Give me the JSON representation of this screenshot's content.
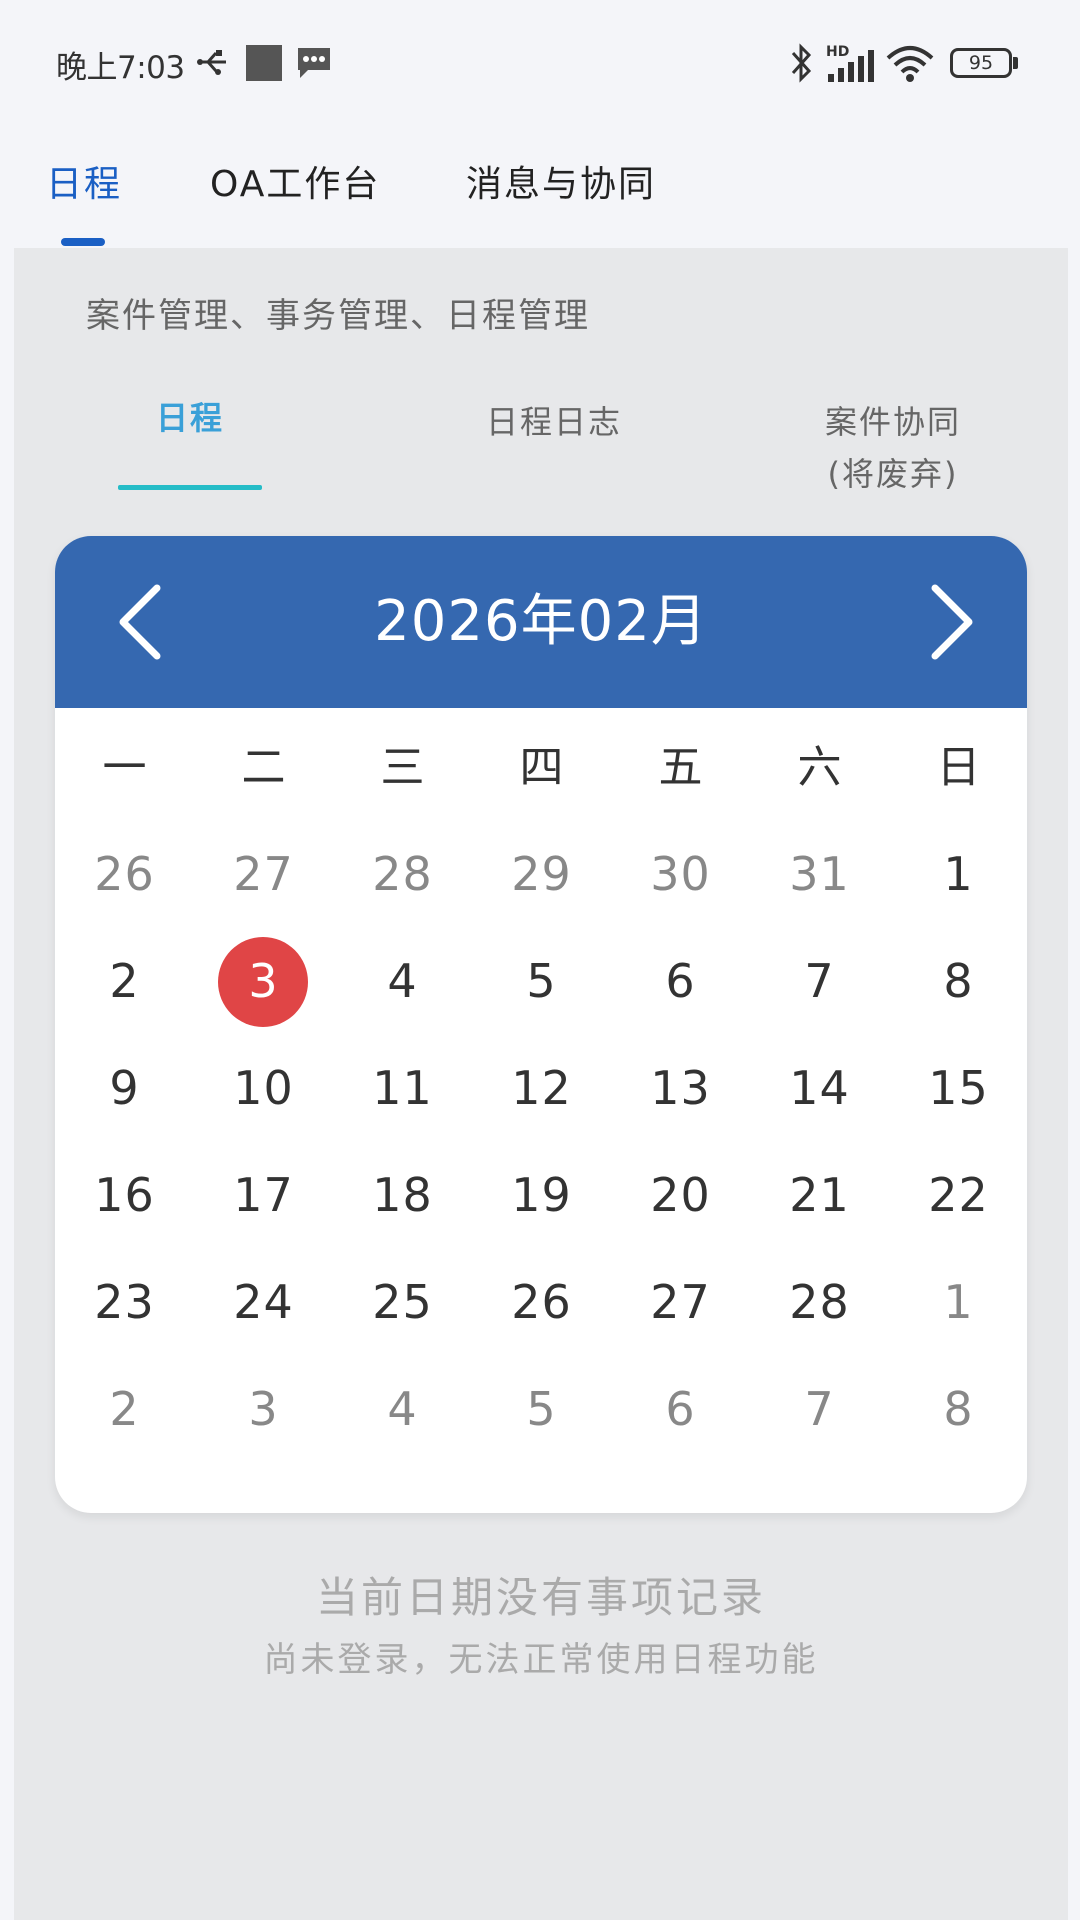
{
  "status_bar": {
    "time": "晚上7:03",
    "network_label": "HD",
    "battery": "95",
    "icons": [
      "usb-debug-icon",
      "app-square-icon",
      "message-icon",
      "bluetooth-icon",
      "signal-icon",
      "wifi-icon",
      "battery-icon"
    ]
  },
  "top_tabs": [
    "日程",
    "OA工作台",
    "消息与协同"
  ],
  "active_top_tab": "日程",
  "subtitle": "案件管理、事务管理、日程管理",
  "sub_tabs": [
    "日程",
    "日程日志",
    "案件协同",
    "(将废弃)"
  ],
  "calendar": {
    "title": "2026年02月",
    "weekdays": [
      "一",
      "二",
      "三",
      "四",
      "五",
      "六",
      "日"
    ],
    "weeks": [
      [
        "26",
        "27",
        "28",
        "29",
        "30",
        "31",
        "1"
      ],
      [
        "2",
        "3",
        "4",
        "5",
        "6",
        "7",
        "8"
      ],
      [
        "9",
        "10",
        "11",
        "12",
        "13",
        "14",
        "15"
      ],
      [
        "16",
        "17",
        "18",
        "19",
        "20",
        "21",
        "22"
      ],
      [
        "23",
        "24",
        "25",
        "26",
        "27",
        "28",
        "1"
      ],
      [
        "2",
        "3",
        "4",
        "5",
        "6",
        "7",
        "8"
      ]
    ],
    "selected_day": "3",
    "colors": {
      "header": "#3568b0",
      "today": "#e04546"
    }
  },
  "empty_state": {
    "title": "当前日期没有事项记录",
    "message": "尚未登录，无法正常使用日程功能"
  }
}
